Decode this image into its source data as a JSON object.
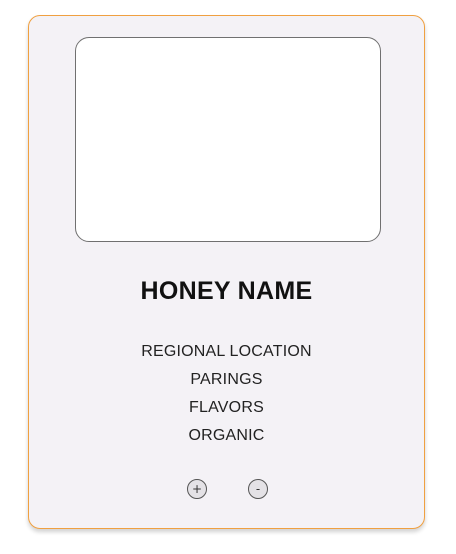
{
  "card": {
    "title": "HONEY NAME",
    "details": [
      "REGIONAL LOCATION",
      "PARINGS",
      "FLAVORS",
      "ORGANIC"
    ],
    "buttons": {
      "plus_label": "+",
      "minus_label": "-"
    }
  },
  "colors": {
    "card_background": "#f4f2f6",
    "card_border": "#f0a040",
    "image_background": "#ffffff"
  }
}
